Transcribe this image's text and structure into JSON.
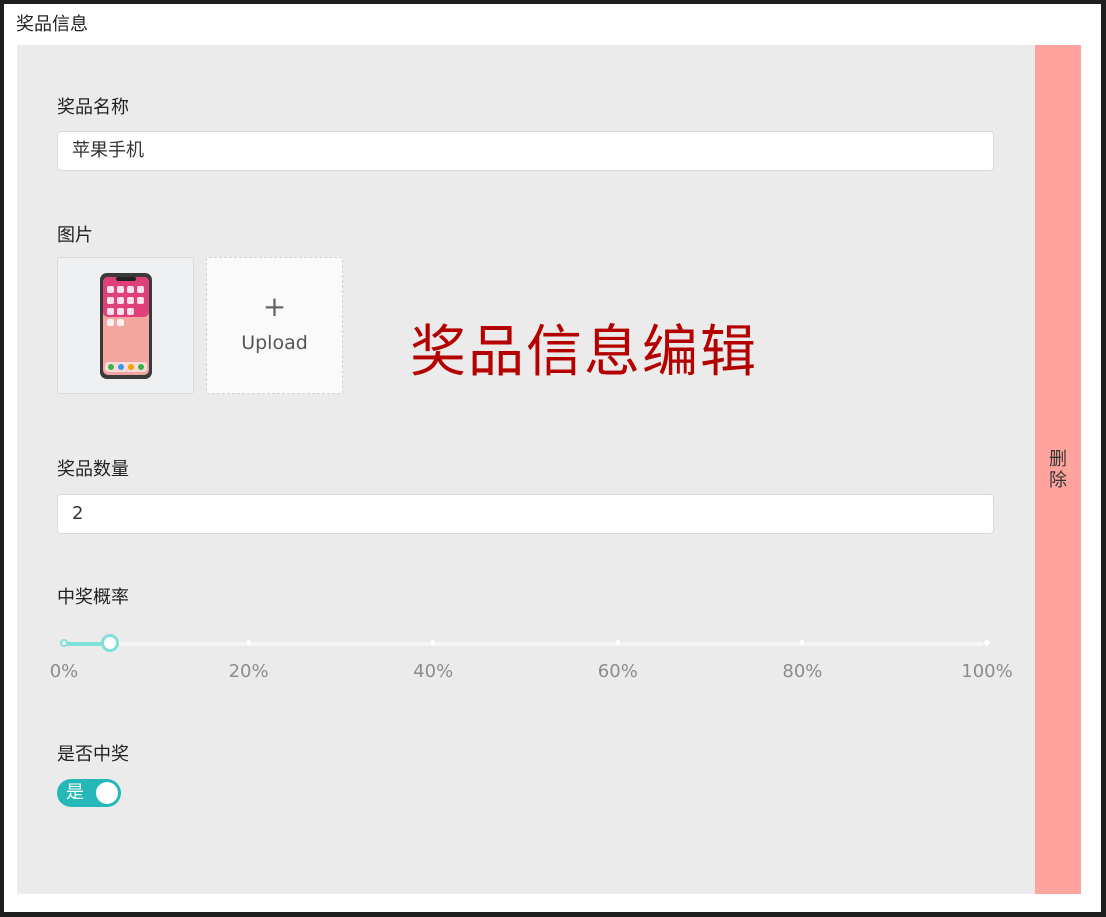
{
  "section_title": "奖品信息",
  "overlay_title": "奖品信息编辑",
  "fields": {
    "name_label": "奖品名称",
    "name_value": "苹果手机",
    "image_label": "图片",
    "upload_label": "Upload",
    "upload_plus": "+",
    "quantity_label": "奖品数量",
    "quantity_value": "2",
    "probability_label": "中奖概率",
    "win_label": "是否中奖",
    "win_switch_text": "是"
  },
  "probability": {
    "value_percent": 5,
    "marks": [
      "0%",
      "20%",
      "40%",
      "60%",
      "80%",
      "100%"
    ]
  },
  "delete_label": "删除",
  "colors": {
    "panel_bg": "#ebebeb",
    "delete_bg": "#ffa39e",
    "accent": "#26b8b8",
    "slider": "#7fe0d8",
    "overlay_text": "#b50000"
  },
  "icons": {
    "thumbnail": "phone-image",
    "upload": "plus-icon"
  }
}
